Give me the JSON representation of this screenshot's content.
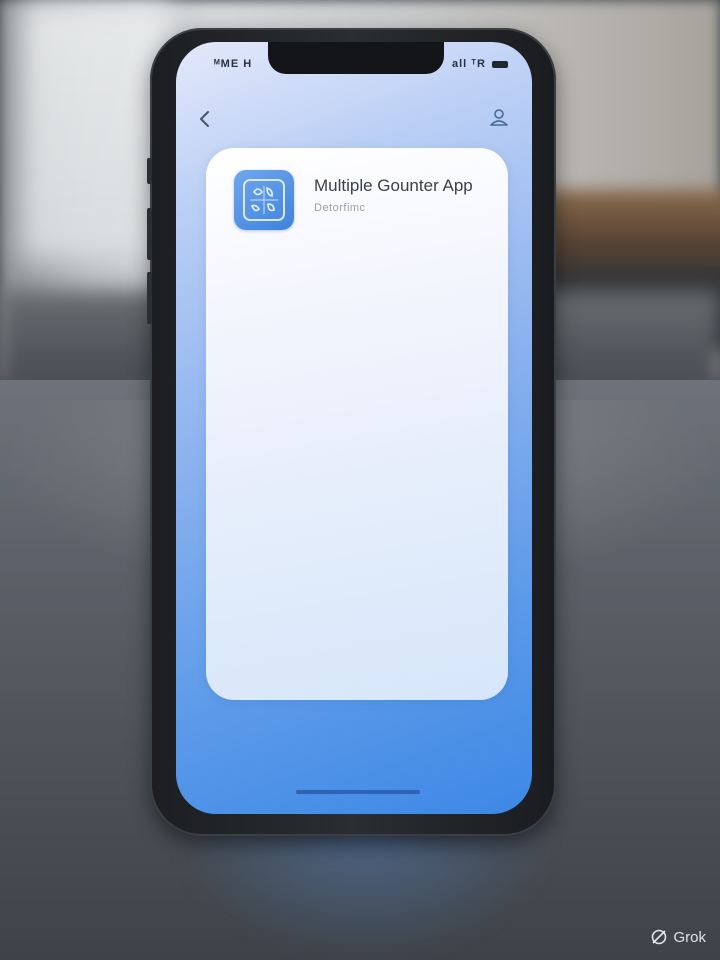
{
  "status_bar": {
    "time": "ᴹME H",
    "signal": "all ᵀR"
  },
  "nav": {
    "back_icon": "chevron-left-icon",
    "profile_icon": "user-icon"
  },
  "app_card": {
    "icon": "counter-app-icon",
    "title": "Multiple Gounter App",
    "subtitle": "Detorfimc"
  },
  "watermark": {
    "text": "Grok",
    "icon": "grok-logo-icon"
  },
  "colors": {
    "screen_top": "#e4e9fb",
    "screen_bottom": "#3d88e6",
    "icon_blue": "#4a8ae2",
    "card_bg": "#f3f5fd"
  }
}
